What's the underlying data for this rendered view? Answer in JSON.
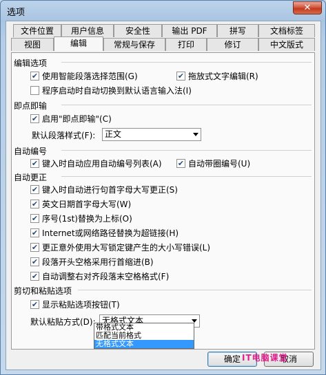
{
  "window": {
    "title": "选项",
    "close_glyph": "✕"
  },
  "tabs_back": [
    "文件位置",
    "用户信息",
    "安全性",
    "输出 PDF",
    "拼写",
    "文档标签"
  ],
  "tabs_front": [
    "视图",
    "编辑",
    "常规与保存",
    "打印",
    "修订",
    "中文版式"
  ],
  "active_tab": "编辑",
  "sections": {
    "edit_options": {
      "title": "编辑选项",
      "smart_paragraph": {
        "label": "使用智能段落选择范围(G)",
        "checked": true
      },
      "drag_drop": {
        "label": "拖放式文字编辑(R)",
        "checked": true
      },
      "auto_ime": {
        "label": "程序启动时自动切换到默认语言输入法(I)",
        "checked": false
      }
    },
    "click_and_type": {
      "title": "即点即输",
      "enable": {
        "label": "启用\"即点即输\"(C)",
        "checked": true
      },
      "default_style_label": "默认段落样式(F):",
      "default_style_value": "正文"
    },
    "auto_numbering": {
      "title": "自动编号",
      "auto_list": {
        "label": "键入时自动应用自动编号列表(A)",
        "checked": true
      },
      "auto_circle": {
        "label": "自动带圈编号(U)",
        "checked": true
      }
    },
    "auto_correct": {
      "title": "自动更正",
      "items": [
        {
          "label": "键入时自动进行句首字母大写更正(S)",
          "checked": true
        },
        {
          "label": "英文日期首字母大写(W)",
          "checked": true
        },
        {
          "label": "序号(1st)替换为上标(O)",
          "checked": true
        },
        {
          "label": "Internet或网络路径替换为超链接(H)",
          "checked": true
        },
        {
          "label": "更正意外使用大写锁定键产生的大小写错误(L)",
          "checked": true
        },
        {
          "label": "段落开头空格采用行首缩进(B)",
          "checked": true
        },
        {
          "label": "自动调整右对齐段落末空格格式(F)",
          "checked": true
        }
      ]
    },
    "cut_paste": {
      "title": "剪切和粘贴选项",
      "show_button": {
        "label": "显示粘贴选项按钮(T)",
        "checked": true
      },
      "default_paste_label": "默认粘贴方式(D):",
      "default_paste_value": "无格式文本",
      "options": [
        "带格式文本",
        "匹配当前格式",
        "无格式文本"
      ]
    }
  },
  "buttons": {
    "ok": "确定",
    "cancel": "取消"
  },
  "watermark": "IT电脑课堂"
}
